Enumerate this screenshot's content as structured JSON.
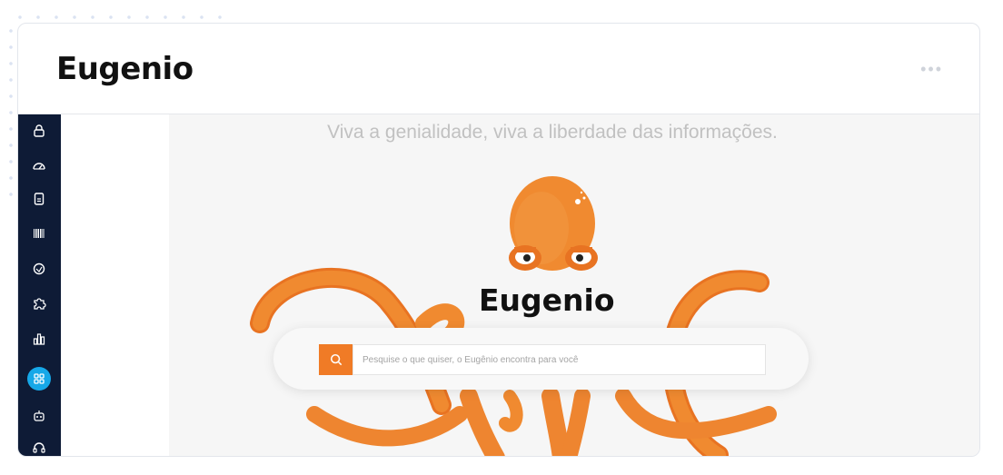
{
  "header": {
    "title": "Eugenio",
    "more_label": "•••"
  },
  "sidebar": {
    "items": [
      {
        "icon": "lock-icon"
      },
      {
        "icon": "speedometer-icon"
      },
      {
        "icon": "document-icon"
      },
      {
        "icon": "barcode-icon"
      },
      {
        "icon": "tag-icon"
      },
      {
        "icon": "puzzle-icon"
      },
      {
        "icon": "bar-chart-icon"
      },
      {
        "icon": "grid-icon",
        "active": true
      },
      {
        "icon": "robot-icon"
      },
      {
        "icon": "headset-icon"
      }
    ]
  },
  "main": {
    "tagline": "Viva a genialidade, viva a liberdade das informações.",
    "logo_text": "Eugenio",
    "search": {
      "placeholder": "Pesquise o que quiser, o Eugênio encontra para você"
    }
  },
  "colors": {
    "accent": "#f07b26",
    "sidebar": "#0e1b36",
    "active": "#16a8e8"
  }
}
